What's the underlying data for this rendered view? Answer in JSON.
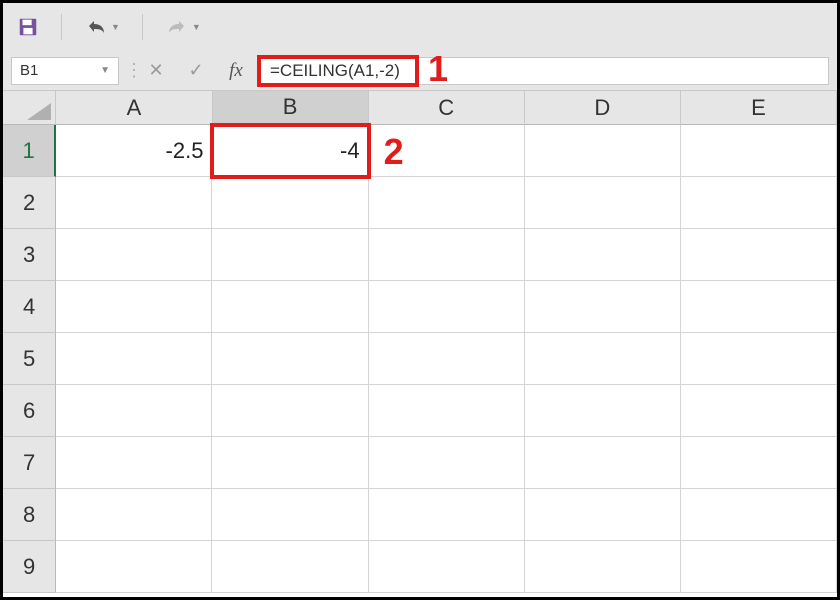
{
  "qat": {
    "save_icon": "save-icon",
    "undo_icon": "undo-icon",
    "redo_icon": "redo-icon"
  },
  "formula_bar": {
    "name_box": "B1",
    "cancel_icon": "cancel-icon",
    "enter_icon": "enter-icon",
    "fx_label": "fx",
    "formula": "=CEILING(A1,-2)"
  },
  "callouts": {
    "one": "1",
    "two": "2"
  },
  "columns": [
    "A",
    "B",
    "C",
    "D",
    "E"
  ],
  "rows": [
    "1",
    "2",
    "3",
    "4",
    "5",
    "6",
    "7",
    "8",
    "9"
  ],
  "active_column_index": 1,
  "active_row_index": 0,
  "cells": {
    "A1": "-2.5",
    "B1": "-4"
  },
  "colors": {
    "accent": "#217346",
    "callout": "#e21b1b"
  }
}
